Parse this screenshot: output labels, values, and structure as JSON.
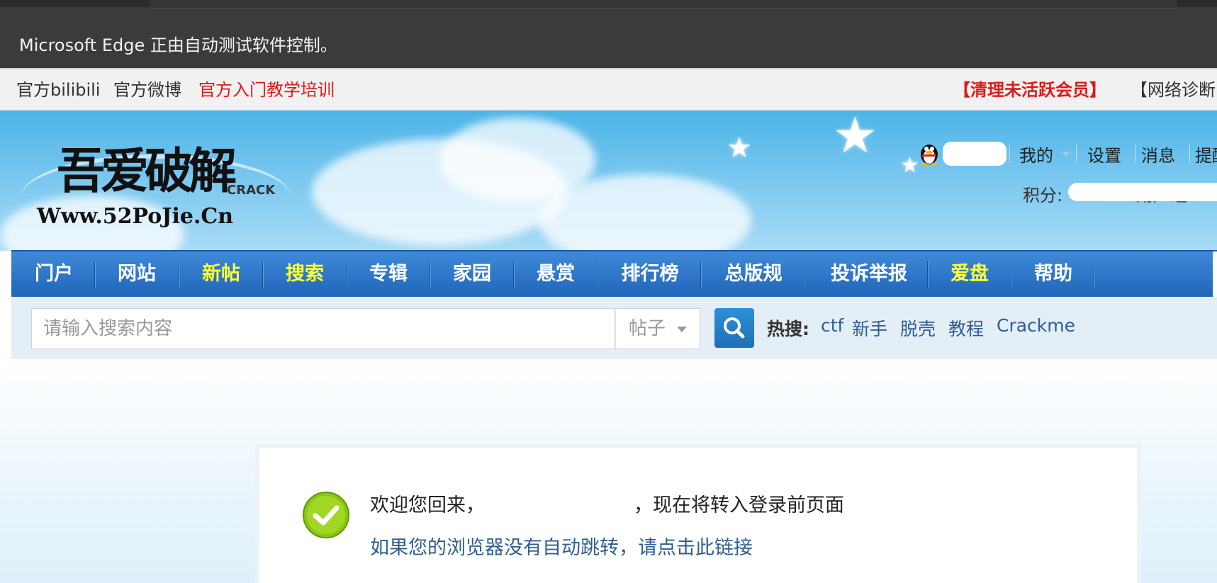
{
  "automation_banner": {
    "text": "Microsoft Edge 正由自动测试软件控制。"
  },
  "toplinks": {
    "items": [
      "官方bilibili",
      "官方微博",
      "官方入门教学培训"
    ],
    "right_items": [
      "【清理未活跃会员】",
      "【网络诊断"
    ]
  },
  "header": {
    "logo": {
      "title": "吾爱破解",
      "url": "Www.52PoJie.Cn",
      "subtitle": "CRACK"
    },
    "user_menu": {
      "mine": "我的",
      "settings": "设置",
      "messages": "消息",
      "remind": "提醒"
    },
    "score_label": "积分:",
    "group_label": "用户组:"
  },
  "nav": {
    "items": [
      "门户",
      "网站",
      "新帖",
      "搜索",
      "专辑",
      "家园",
      "悬赏",
      "排行榜",
      "总版规",
      "投诉举报",
      "爱盘",
      "帮助"
    ]
  },
  "search": {
    "placeholder": "请输入搜索内容",
    "type_selected": "帖子",
    "hot_label": "热搜:",
    "hot_terms": [
      "ctf",
      "新手",
      "脱壳",
      "教程",
      "Crackme"
    ]
  },
  "message": {
    "welcome_prefix": "欢迎您回来，",
    "welcome_suffix": "，现在将转入登录前页面",
    "redirect_link": "如果您的浏览器没有自动跳转，请点击此链接"
  },
  "colors": {
    "nav_bg": "#2a6fc4",
    "nav_highlight": "#ffff33",
    "link": "#2e5e92",
    "red_link": "#e01919"
  }
}
